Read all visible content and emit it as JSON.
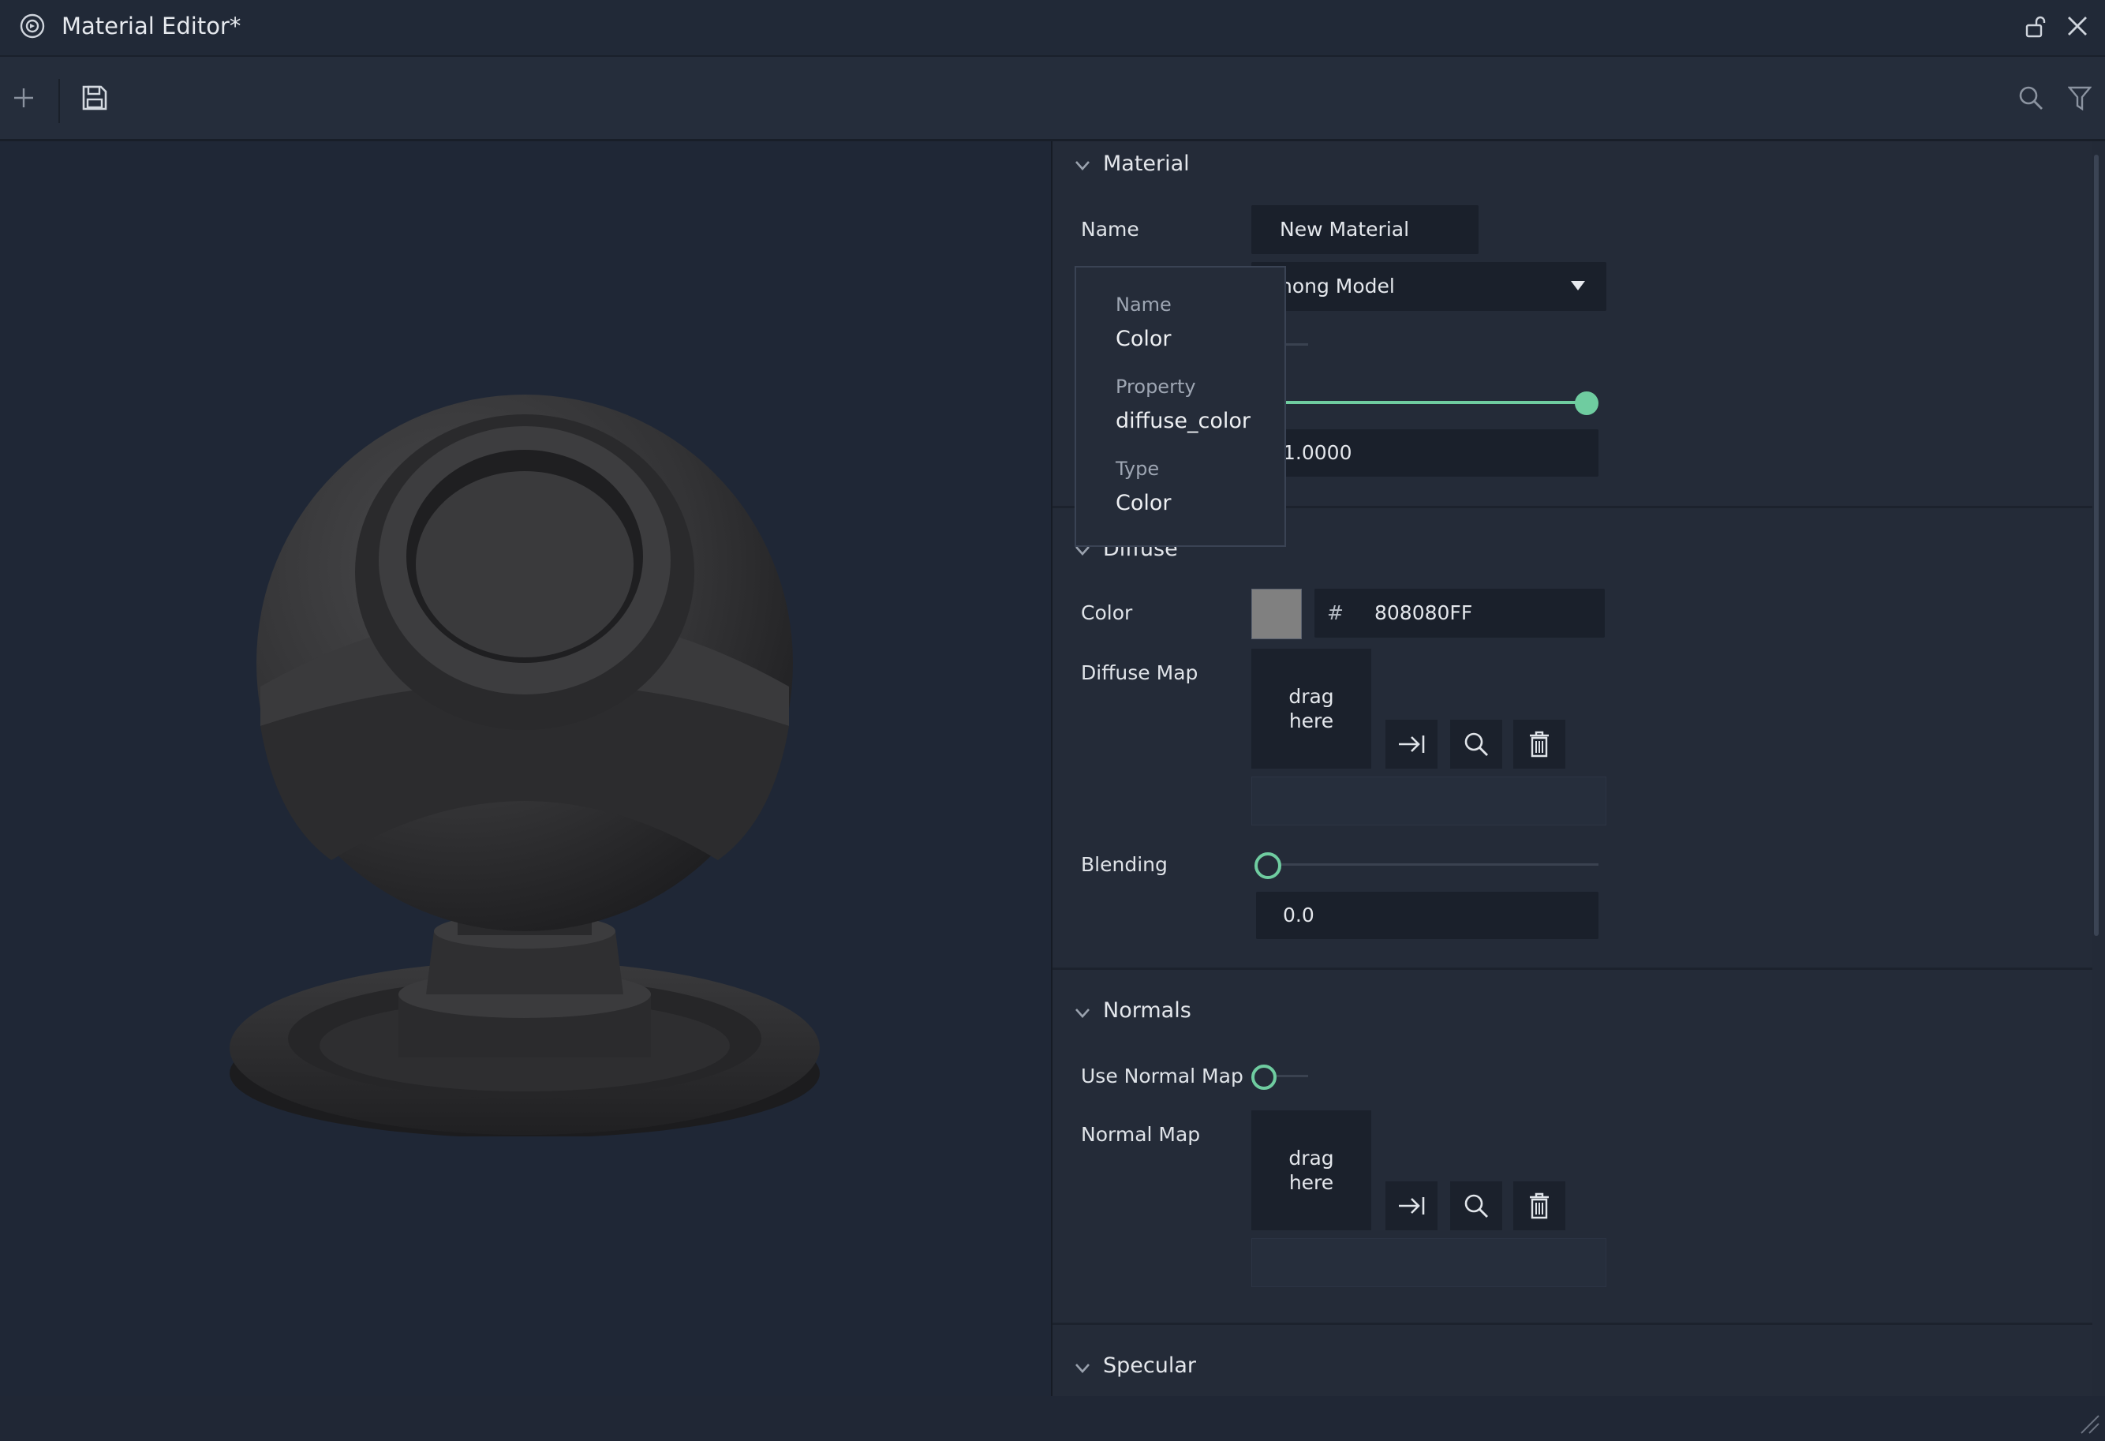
{
  "window": {
    "title": "Material Editor*"
  },
  "toolbar": {
    "add_icon": "plus-icon",
    "save_icon": "save-icon",
    "search_icon": "search-icon",
    "filter_icon": "filter-icon"
  },
  "material": {
    "section_title": "Material",
    "name_label": "Name",
    "name_value": "New Material",
    "shader_value": "hong Model",
    "opacity_value": "1.0000",
    "opacity_level": 1.0
  },
  "diffuse": {
    "section_title": "Diffuse",
    "color_label": "Color",
    "hash": "#",
    "color_hex": "808080FF",
    "swatch_color": "#808080",
    "map_label": "Diffuse Map",
    "drop_line1": "drag",
    "drop_line2": "here",
    "blending_label": "Blending",
    "blending_value": "0.0",
    "blending_level": 0.0
  },
  "normals": {
    "section_title": "Normals",
    "use_normal_label": "Use Normal Map",
    "normal_map_label": "Normal Map",
    "drop_line1": "drag",
    "drop_line2": "here"
  },
  "specular": {
    "section_title": "Specular"
  },
  "tooltip": {
    "name_key": "Name",
    "name_val": "Color",
    "property_key": "Property",
    "property_val": "diffuse_color",
    "type_key": "Type",
    "type_val": "Color"
  },
  "colors": {
    "accent": "#6fcca0",
    "background": "#1e2532"
  }
}
